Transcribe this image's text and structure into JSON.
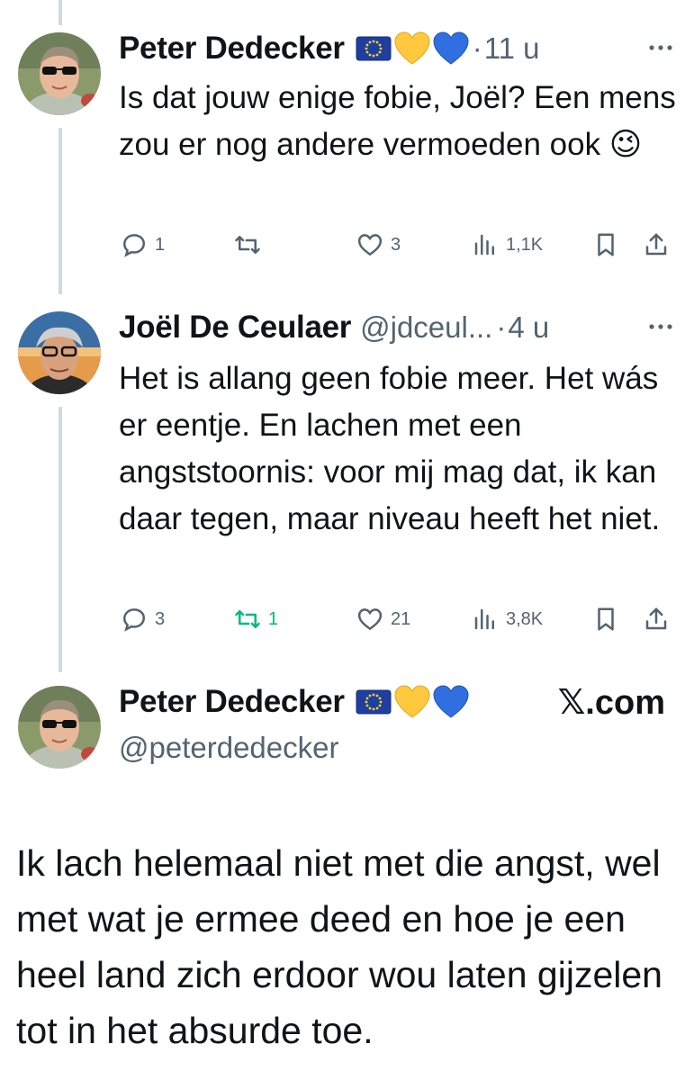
{
  "tweets": [
    {
      "name": "Peter Dedecker",
      "badges": [
        "eu-flag",
        "yellow-heart",
        "blue-heart"
      ],
      "separator": "·",
      "time": "11 u",
      "text": "Is dat jouw enige fobie, Joël? Een mens zou er nog andere vermoeden ook 😉",
      "stats": {
        "replies": "1",
        "retweets": "",
        "likes": "3",
        "views": "1,1K"
      }
    },
    {
      "name": "Joël De Ceulaer",
      "handle": "@jdceul...",
      "separator": "·",
      "time": "4 u",
      "text": "Het is allang geen fobie meer. Het wás er eentje. En lachen met een angststoornis: voor mij mag dat, ik kan daar tegen, maar niveau heeft het niet.",
      "stats": {
        "replies": "3",
        "retweets": "1",
        "likes": "21",
        "views": "3,8K"
      }
    }
  ],
  "quote": {
    "name": "Peter Dedecker",
    "handle": "@peterdedecker",
    "brand": "𝕏.com",
    "text": "Ik lach helemaal niet met die angst, wel met wat je ermee deed en hoe je een heel land zich erdoor wou laten gijzelen tot in het absurde toe."
  },
  "colors": {
    "text": "#0f1419",
    "secondary": "#536471",
    "retweet_active": "#00ba7c",
    "thread_line": "#cfd9de"
  }
}
